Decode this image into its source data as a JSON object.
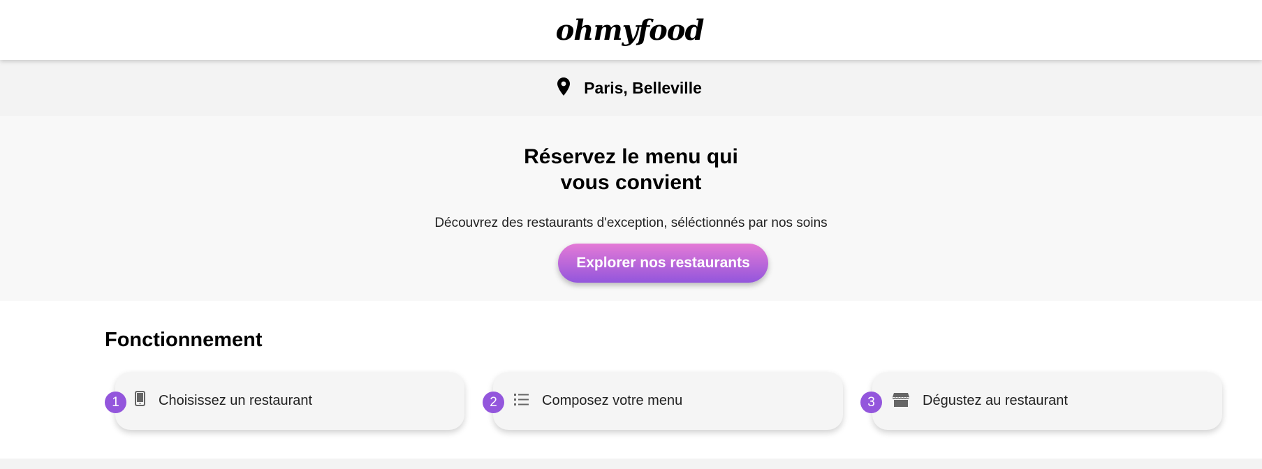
{
  "header": {
    "logo": "ohmyfood"
  },
  "location": {
    "icon": "map-pin-icon",
    "text": "Paris, Belleville"
  },
  "hero": {
    "title_line1": "Réservez le menu qui",
    "title_line2": "vous convient",
    "subtitle": "Découvrez des restaurants d'exception, séléctionnés par nos soins",
    "button_label": "Explorer nos restaurants"
  },
  "how_it_works": {
    "title": "Fonctionnement",
    "steps": [
      {
        "number": "1",
        "icon": "smartphone-icon",
        "label": "Choisissez un restaurant"
      },
      {
        "number": "2",
        "icon": "list-icon",
        "label": "Composez votre menu"
      },
      {
        "number": "3",
        "icon": "store-icon",
        "label": "Dégustez au restaurant"
      }
    ]
  },
  "colors": {
    "accent": "#9356dc",
    "gradient_start": "#e47ad6",
    "gradient_end": "#9356dc"
  }
}
